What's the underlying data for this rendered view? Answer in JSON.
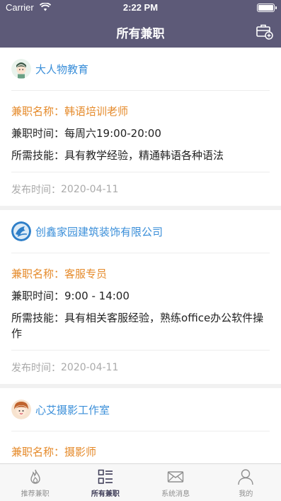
{
  "status": {
    "carrier": "Carrier",
    "time": "2:22 PM"
  },
  "nav": {
    "title": "所有兼职",
    "action_icon": "briefcase-add-icon"
  },
  "labels": {
    "name": "兼职名称：",
    "time": "兼职时间：",
    "skill": "所需技能：",
    "publish": "发布时间："
  },
  "jobs": [
    {
      "company": "大人物教育",
      "name": "韩语培训老师",
      "time": "每周六19:00-20:00",
      "skill": "具有教学经验，精通韩语各种语法",
      "date": "2020-04-11"
    },
    {
      "company": "创鑫家园建筑装饰有限公司",
      "name": "客服专员",
      "time": "9:00 - 14:00",
      "skill": "具有相关客服经验，熟练office办公软件操作",
      "date": "2020-04-11"
    },
    {
      "company": "心艾摄影工作室",
      "name": "摄影师"
    }
  ],
  "tabs": [
    {
      "label": "推荐兼职",
      "icon": "flame-icon"
    },
    {
      "label": "所有兼职",
      "icon": "list-icon"
    },
    {
      "label": "系统消息",
      "icon": "mail-icon"
    },
    {
      "label": "我的",
      "icon": "person-icon"
    }
  ],
  "colors": {
    "nav_bg": "#5d5a78",
    "company": "#3b8fd9",
    "job_name": "#e58a2a",
    "date": "#aaaaaa"
  }
}
